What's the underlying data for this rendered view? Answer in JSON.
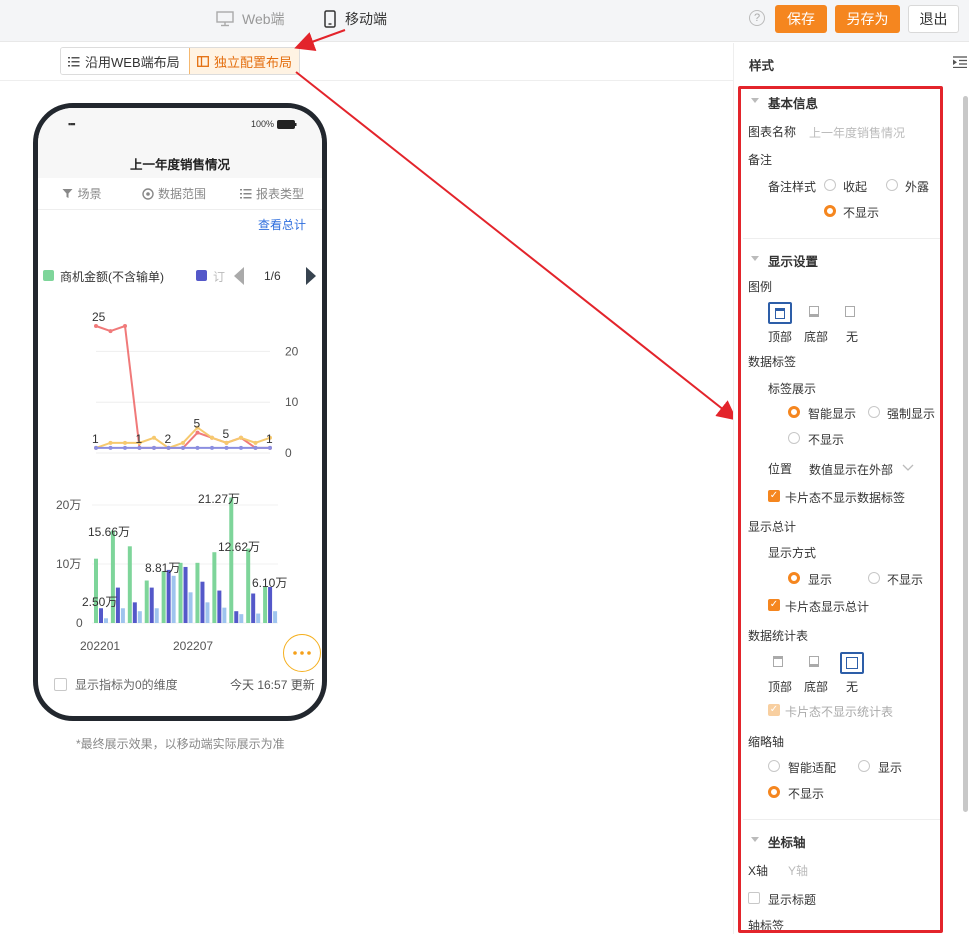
{
  "topbar": {
    "web_label": "Web端",
    "mobile_label": "移动端",
    "help": "?",
    "save": "保存",
    "save_as": "另存为",
    "exit": "退出"
  },
  "layout_toggle": {
    "inherit": "沿用WEB端布局",
    "independent": "独立配置布局"
  },
  "phone": {
    "signal": "▪▪▪",
    "battery": "100%",
    "title": "上一年度销售情况",
    "tabs": [
      "场景",
      "数据范围",
      "报表类型"
    ],
    "view_total": "查看总计",
    "legend_item1": "商机金额(不含输单)",
    "legend_item2": "订",
    "legend_page": "1/6",
    "line_labels": [
      "25",
      "1",
      "1",
      "2",
      "5",
      "5",
      "1"
    ],
    "right_ticks": [
      "20",
      "10",
      "0"
    ],
    "bar_labels": [
      "15.66万",
      "2.50万",
      "8.81万",
      "21.27万",
      "12.62万",
      "6.10万"
    ],
    "left_ticks": [
      "20万",
      "10万",
      "0"
    ],
    "x_ticks": [
      "202201",
      "202207"
    ],
    "zero_dim_label": "显示指标为0的维度",
    "updated": "今天 16:57 更新"
  },
  "caption": "*最终展示效果，以移动端实际展示为准",
  "chart_data": {
    "type": "line",
    "line_chart": {
      "y_right_range": [
        0,
        25
      ],
      "series": [
        {
          "name": "",
          "color": "#f07a7a",
          "values": [
            25,
            24,
            25,
            1,
            1,
            1,
            1,
            4,
            3,
            2,
            3,
            1,
            1
          ]
        },
        {
          "name": "",
          "color": "#f6c96e",
          "values": [
            1,
            2,
            2,
            2,
            3,
            1,
            2,
            5,
            3,
            2,
            3,
            2,
            3
          ]
        },
        {
          "name": "",
          "color": "#8b8ee0",
          "values": [
            1,
            1,
            1,
            1,
            1,
            1,
            1,
            1,
            1,
            1,
            1,
            1,
            1
          ]
        }
      ]
    },
    "bar_chart": {
      "y_left_range": [
        0,
        20
      ],
      "x": [
        "202201",
        "202207"
      ],
      "series": [
        {
          "name": "商机金额(不含输单)",
          "color": "#7ed59a",
          "values": [
            10.9,
            15.66,
            13.0,
            7.2,
            8.81,
            10.2,
            10.2,
            12.0,
            21.27,
            12.62,
            6.1
          ]
        },
        {
          "name": "订",
          "color": "#5458c9",
          "values": [
            2.5,
            6.0,
            3.5,
            6.0,
            9.0,
            9.5,
            7.0,
            5.5,
            2.0,
            5.0,
            6.1
          ]
        },
        {
          "name": "",
          "color": "#9fc4ee",
          "values": [
            0.8,
            2.5,
            2.0,
            2.5,
            8.0,
            5.2,
            3.5,
            2.6,
            1.5,
            1.6,
            2.0
          ]
        }
      ]
    }
  },
  "panel": {
    "title": "样式",
    "basic": {
      "header": "基本信息",
      "chart_name_label": "图表名称",
      "chart_name_placeholder": "上一年度销售情况",
      "note": "备注",
      "note_style": "备注样式",
      "opt_collapse": "收起",
      "opt_expose": "外露",
      "opt_hide": "不显示"
    },
    "display": {
      "header": "显示设置",
      "legend": "图例",
      "top": "顶部",
      "bottom": "底部",
      "none": "无",
      "data_label": "数据标签",
      "label_display": "标签展示",
      "smart": "智能显示",
      "force": "强制显示",
      "hide": "不显示",
      "position": "位置",
      "position_value": "数值显示在外部",
      "card_no_label": "卡片态不显示数据标签",
      "show_total": "显示总计",
      "show_mode": "显示方式",
      "show": "显示",
      "no_show": "不显示",
      "card_total": "卡片态显示总计",
      "stat_table": "数据统计表",
      "card_no_stat": "卡片态不显示统计表",
      "thumb_axis": "缩略轴",
      "thumb_smart": "智能适配",
      "thumb_show": "显示",
      "thumb_hide": "不显示"
    },
    "axis": {
      "header": "坐标轴",
      "x": "X轴",
      "y": "Y轴",
      "show_title": "显示标题",
      "axis_label": "轴标签"
    }
  }
}
